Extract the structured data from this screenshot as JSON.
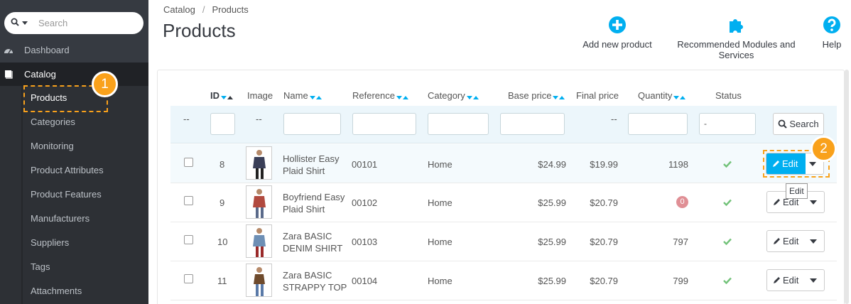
{
  "sidebar": {
    "search": {
      "placeholder": "Search"
    },
    "items": [
      {
        "label": "Dashboard"
      },
      {
        "label": "Catalog"
      }
    ],
    "catalog_sub": [
      "Products",
      "Categories",
      "Monitoring",
      "Product Attributes",
      "Product Features",
      "Manufacturers",
      "Suppliers",
      "Tags",
      "Attachments"
    ]
  },
  "callouts": {
    "one": "1",
    "two": "2"
  },
  "header": {
    "breadcrumb": [
      "Catalog",
      "Products"
    ],
    "breadcrumb_sep": "/",
    "title": "Products",
    "toolbar": {
      "add": "Add new product",
      "modules": "Recommended Modules and Services",
      "help": "Help"
    }
  },
  "table": {
    "columns": {
      "id": "ID",
      "image": "Image",
      "name": "Name",
      "reference": "Reference",
      "category": "Category",
      "base_price": "Base price",
      "final_price": "Final price",
      "quantity": "Quantity",
      "status": "Status"
    },
    "filters": {
      "dash": "--",
      "status_value": "-",
      "search_label": "Search"
    },
    "edit_label": "Edit",
    "tooltip": "Edit",
    "rows": [
      {
        "id": "8",
        "name1": "Hollister Easy",
        "name2": "Plaid Shirt",
        "reference": "00101",
        "category": "Home",
        "base_price": "$24.99",
        "final_price": "$19.99",
        "quantity": "1198"
      },
      {
        "id": "9",
        "name1": "Boyfriend Easy",
        "name2": "Plaid Shirt",
        "reference": "00102",
        "category": "Home",
        "base_price": "$25.99",
        "final_price": "$20.79",
        "quantity": "0"
      },
      {
        "id": "10",
        "name1": "Zara BASIC",
        "name2": "DENIM SHIRT",
        "reference": "00103",
        "category": "Home",
        "base_price": "$25.99",
        "final_price": "$20.79",
        "quantity": "797"
      },
      {
        "id": "11",
        "name1": "Zara BASIC",
        "name2": "STRAPPY TOP",
        "reference": "00104",
        "category": "Home",
        "base_price": "$25.99",
        "final_price": "$20.79",
        "quantity": "799"
      }
    ]
  },
  "colors": {
    "accent": "#00aff0",
    "callout": "#f9a11b",
    "sidebar": "#363a41",
    "check": "#72c279",
    "zero": "#e08f95"
  }
}
